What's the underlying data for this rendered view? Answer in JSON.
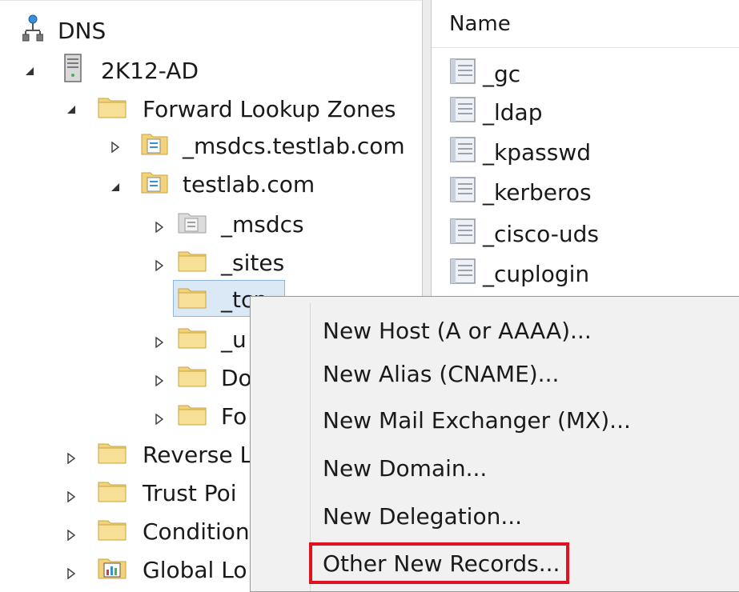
{
  "tree": {
    "root_label": "DNS",
    "server_label": "2K12-AD",
    "forward_label": "Forward Lookup Zones",
    "msdcs_zone_label": "_msdcs.testlab.com",
    "testlab_label": "testlab.com",
    "msdcs_sub_label": "_msdcs",
    "sites_label": "_sites",
    "tcp_label": "_tcp",
    "udp_label": "_u",
    "domain_dns_label": "Do",
    "forest_dns_label": "Fo",
    "reverse_label": "Reverse L",
    "trust_label": "Trust Poi",
    "conditional_label": "Condition",
    "global_label": "Global Lo"
  },
  "list": {
    "column_name": "Name",
    "items": [
      "_gc",
      "_ldap",
      "_kpasswd",
      "_kerberos",
      "_cisco-uds",
      "_cuplogin"
    ]
  },
  "context_menu": {
    "items": [
      "New Host (A or AAAA)...",
      "New Alias (CNAME)...",
      "New Mail Exchanger (MX)...",
      "New Domain...",
      "New Delegation...",
      "Other New Records..."
    ],
    "highlight_color": "#e0121e"
  },
  "icons": {
    "dns_root": "network-icon",
    "server": "server-icon",
    "folder": "folder-icon",
    "zone": "zone-icon",
    "record": "document-icon",
    "global": "global-catalog-icon"
  }
}
